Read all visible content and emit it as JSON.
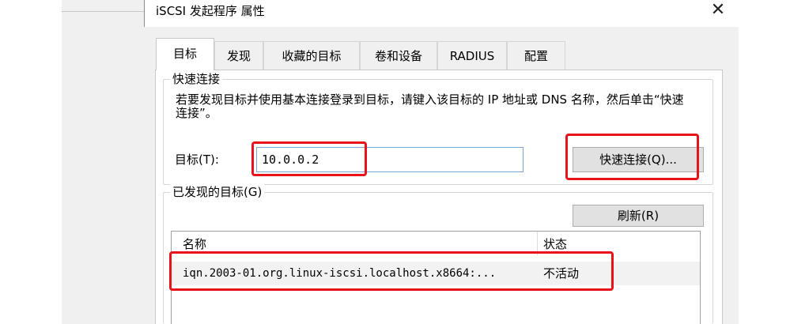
{
  "window": {
    "title": "iSCSI 发起程序 属性",
    "close_glyph": "✕"
  },
  "tabs": [
    {
      "label": "目标",
      "active": true
    },
    {
      "label": "发现"
    },
    {
      "label": "收藏的目标"
    },
    {
      "label": "卷和设备"
    },
    {
      "label": "RADIUS"
    },
    {
      "label": "配置"
    }
  ],
  "quick_connect": {
    "group_label": "快速连接",
    "description": "若要发现目标并使用基本连接登录到目标，请键入该目标的 IP 地址或 DNS 名称，然后单击“快速连接”。",
    "target_label": "目标(T):",
    "target_value": "10.0.0.2",
    "button_label": "快速连接(Q)..."
  },
  "discovered": {
    "group_label": "已发现的目标(G)",
    "refresh_label": "刷新(R)",
    "columns": [
      "名称",
      "状态"
    ],
    "rows": [
      {
        "name": "iqn.2003-01.org.linux-iscsi.localhost.x8664:...",
        "status": "不活动"
      }
    ]
  },
  "colors": {
    "highlight": "#e8121b",
    "input_border": "#7aa7d6"
  }
}
